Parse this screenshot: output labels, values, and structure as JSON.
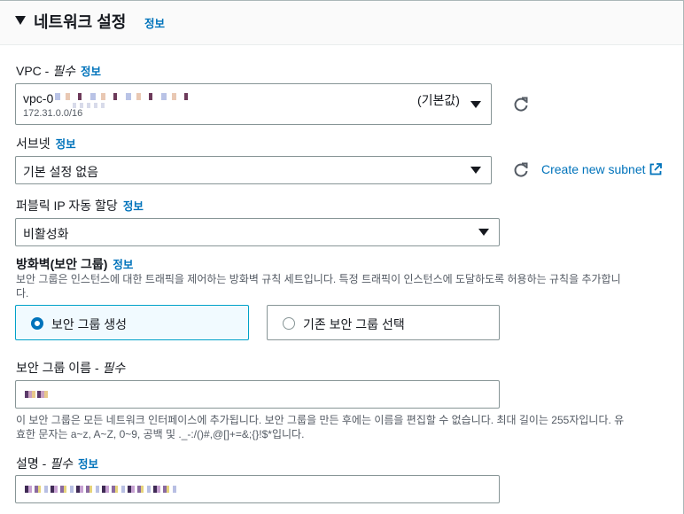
{
  "section": {
    "title": "네트워크 설정",
    "info": "정보"
  },
  "vpc": {
    "label": "VPC - ",
    "required": "필수",
    "info": "정보",
    "value": "vpc-0",
    "cidr": "172.31.0.0/16",
    "default_tag": "(기본값)"
  },
  "subnet": {
    "label": "서브넷",
    "info": "정보",
    "value": "기본 설정 없음",
    "create_link": "Create new subnet"
  },
  "public_ip": {
    "label": "퍼블릭 IP 자동 할당",
    "info": "정보",
    "value": "비활성화"
  },
  "firewall": {
    "label": "방화벽(보안 그룹)",
    "info": "정보",
    "description_line1": "보안 그룹은 인스턴스에 대한 트래픽을 제어하는 방화벽 규칙 세트입니다. 특정 트래픽이 인스턴스에 도달하도록 허용하는 규칙을 추가합니",
    "description_line2": "다.",
    "options": [
      {
        "label": "보안 그룹 생성",
        "selected": true
      },
      {
        "label": "기존 보안 그룹 선택",
        "selected": false
      }
    ]
  },
  "sg_name": {
    "label": "보안 그룹 이름 - ",
    "required": "필수",
    "hint_line1": "이 보안 그룹은 모든 네트워크 인터페이스에 추가됩니다. 보안 그룹을 만든 후에는 이름을 편집할 수 없습니다. 최대 길이는 255자입니다. 유",
    "hint_line2": "효한 문자는 a~z, A~Z, 0~9, 공백 및 ._-:/()#,@[]+=&;{}!$*입니다."
  },
  "sg_desc": {
    "label": "설명 - ",
    "required": "필수",
    "info": "정보"
  },
  "icons": {
    "collapse": "caret-down-icon",
    "dropdown": "caret-down-icon",
    "refresh": "refresh-icon",
    "external": "external-link-icon",
    "radio": "radio-icon"
  },
  "colors": {
    "link": "#0073bb",
    "selected_border": "#00a1c9",
    "selected_bg": "#f1faff",
    "text": "#16191f",
    "muted": "#545b64"
  }
}
